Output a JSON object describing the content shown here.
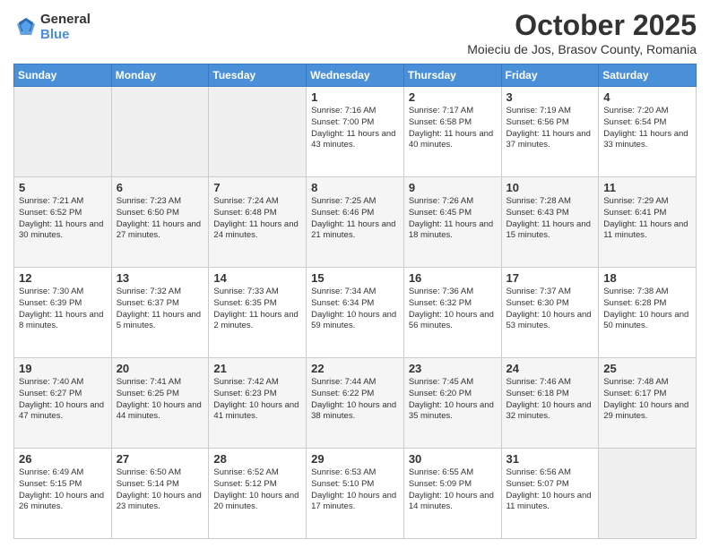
{
  "logo": {
    "general": "General",
    "blue": "Blue"
  },
  "header": {
    "month": "October 2025",
    "location": "Moieciu de Jos, Brasov County, Romania"
  },
  "weekdays": [
    "Sunday",
    "Monday",
    "Tuesday",
    "Wednesday",
    "Thursday",
    "Friday",
    "Saturday"
  ],
  "weeks": [
    [
      {
        "day": "",
        "info": ""
      },
      {
        "day": "",
        "info": ""
      },
      {
        "day": "",
        "info": ""
      },
      {
        "day": "1",
        "info": "Sunrise: 7:16 AM\nSunset: 7:00 PM\nDaylight: 11 hours\nand 43 minutes."
      },
      {
        "day": "2",
        "info": "Sunrise: 7:17 AM\nSunset: 6:58 PM\nDaylight: 11 hours\nand 40 minutes."
      },
      {
        "day": "3",
        "info": "Sunrise: 7:19 AM\nSunset: 6:56 PM\nDaylight: 11 hours\nand 37 minutes."
      },
      {
        "day": "4",
        "info": "Sunrise: 7:20 AM\nSunset: 6:54 PM\nDaylight: 11 hours\nand 33 minutes."
      }
    ],
    [
      {
        "day": "5",
        "info": "Sunrise: 7:21 AM\nSunset: 6:52 PM\nDaylight: 11 hours\nand 30 minutes."
      },
      {
        "day": "6",
        "info": "Sunrise: 7:23 AM\nSunset: 6:50 PM\nDaylight: 11 hours\nand 27 minutes."
      },
      {
        "day": "7",
        "info": "Sunrise: 7:24 AM\nSunset: 6:48 PM\nDaylight: 11 hours\nand 24 minutes."
      },
      {
        "day": "8",
        "info": "Sunrise: 7:25 AM\nSunset: 6:46 PM\nDaylight: 11 hours\nand 21 minutes."
      },
      {
        "day": "9",
        "info": "Sunrise: 7:26 AM\nSunset: 6:45 PM\nDaylight: 11 hours\nand 18 minutes."
      },
      {
        "day": "10",
        "info": "Sunrise: 7:28 AM\nSunset: 6:43 PM\nDaylight: 11 hours\nand 15 minutes."
      },
      {
        "day": "11",
        "info": "Sunrise: 7:29 AM\nSunset: 6:41 PM\nDaylight: 11 hours\nand 11 minutes."
      }
    ],
    [
      {
        "day": "12",
        "info": "Sunrise: 7:30 AM\nSunset: 6:39 PM\nDaylight: 11 hours\nand 8 minutes."
      },
      {
        "day": "13",
        "info": "Sunrise: 7:32 AM\nSunset: 6:37 PM\nDaylight: 11 hours\nand 5 minutes."
      },
      {
        "day": "14",
        "info": "Sunrise: 7:33 AM\nSunset: 6:35 PM\nDaylight: 11 hours\nand 2 minutes."
      },
      {
        "day": "15",
        "info": "Sunrise: 7:34 AM\nSunset: 6:34 PM\nDaylight: 10 hours\nand 59 minutes."
      },
      {
        "day": "16",
        "info": "Sunrise: 7:36 AM\nSunset: 6:32 PM\nDaylight: 10 hours\nand 56 minutes."
      },
      {
        "day": "17",
        "info": "Sunrise: 7:37 AM\nSunset: 6:30 PM\nDaylight: 10 hours\nand 53 minutes."
      },
      {
        "day": "18",
        "info": "Sunrise: 7:38 AM\nSunset: 6:28 PM\nDaylight: 10 hours\nand 50 minutes."
      }
    ],
    [
      {
        "day": "19",
        "info": "Sunrise: 7:40 AM\nSunset: 6:27 PM\nDaylight: 10 hours\nand 47 minutes."
      },
      {
        "day": "20",
        "info": "Sunrise: 7:41 AM\nSunset: 6:25 PM\nDaylight: 10 hours\nand 44 minutes."
      },
      {
        "day": "21",
        "info": "Sunrise: 7:42 AM\nSunset: 6:23 PM\nDaylight: 10 hours\nand 41 minutes."
      },
      {
        "day": "22",
        "info": "Sunrise: 7:44 AM\nSunset: 6:22 PM\nDaylight: 10 hours\nand 38 minutes."
      },
      {
        "day": "23",
        "info": "Sunrise: 7:45 AM\nSunset: 6:20 PM\nDaylight: 10 hours\nand 35 minutes."
      },
      {
        "day": "24",
        "info": "Sunrise: 7:46 AM\nSunset: 6:18 PM\nDaylight: 10 hours\nand 32 minutes."
      },
      {
        "day": "25",
        "info": "Sunrise: 7:48 AM\nSunset: 6:17 PM\nDaylight: 10 hours\nand 29 minutes."
      }
    ],
    [
      {
        "day": "26",
        "info": "Sunrise: 6:49 AM\nSunset: 5:15 PM\nDaylight: 10 hours\nand 26 minutes."
      },
      {
        "day": "27",
        "info": "Sunrise: 6:50 AM\nSunset: 5:14 PM\nDaylight: 10 hours\nand 23 minutes."
      },
      {
        "day": "28",
        "info": "Sunrise: 6:52 AM\nSunset: 5:12 PM\nDaylight: 10 hours\nand 20 minutes."
      },
      {
        "day": "29",
        "info": "Sunrise: 6:53 AM\nSunset: 5:10 PM\nDaylight: 10 hours\nand 17 minutes."
      },
      {
        "day": "30",
        "info": "Sunrise: 6:55 AM\nSunset: 5:09 PM\nDaylight: 10 hours\nand 14 minutes."
      },
      {
        "day": "31",
        "info": "Sunrise: 6:56 AM\nSunset: 5:07 PM\nDaylight: 10 hours\nand 11 minutes."
      },
      {
        "day": "",
        "info": ""
      }
    ]
  ]
}
